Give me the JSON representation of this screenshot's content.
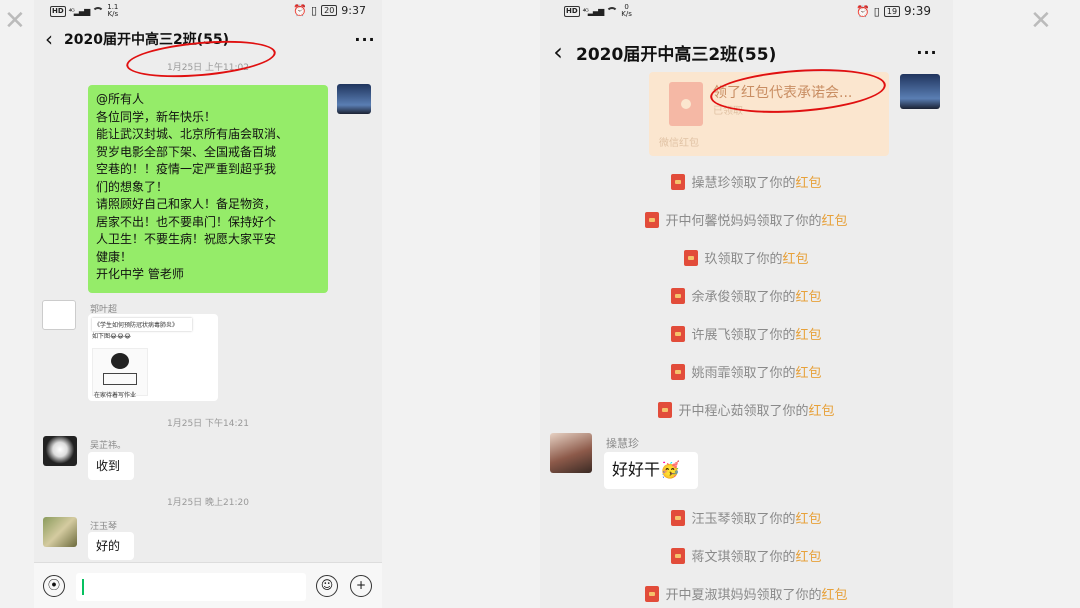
{
  "left": {
    "status": {
      "speed": "1.1\nK/s",
      "battery": "20",
      "time": "9:37"
    },
    "title": "2020届开中高三2班(55)",
    "timestamp1": "1月25日 上午11:02",
    "announcement": [
      "@所有人",
      "各位同学，新年快乐！",
      "能让武汉封城、北京所有庙会取消、",
      "贺岁电影全部下架、全国戒备百城",
      "空巷的！！疫情一定严重到超乎我",
      "们的想象了！",
      "请照顾好自己和家人！备足物资，",
      "居家不出！也不要串门！保持好个",
      "人卫生！不要生病！祝愿大家平安",
      "健康！",
      "开化中学    管老师"
    ],
    "sender1": "郭叶超",
    "image_msg": {
      "caption": "《学生如何预防冠状病毒肺炎》",
      "line2": "如下图😂😂😂",
      "footer": "在家待着写作业"
    },
    "timestamp2": "1月25日 下午14:21",
    "sender2": "吴芷祎。",
    "msg2": "收到",
    "timestamp3": "1月25日 晚上21:20",
    "sender3": "汪玉琴",
    "msg3": "好的"
  },
  "right": {
    "status": {
      "speed": "0\nK/s",
      "battery": "19",
      "time": "9:39"
    },
    "title": "2020届开中高三2班(55)",
    "redpacket": {
      "title": "领了红包代表承诺会...",
      "sub": "已领取",
      "label": "微信红包"
    },
    "system_suffix": "领取了你的",
    "hongbao_word": "红包",
    "claims_before": [
      "操慧珍",
      "开中何馨悦妈妈",
      "玖",
      "余承俊",
      "许展飞",
      "姚雨霏",
      "开中程心茹"
    ],
    "sender": "操慧珍",
    "msg": "好好干🥳",
    "claims_after": [
      "汪玉琴",
      "蒋文琪",
      "开中夏淑琪妈妈"
    ]
  },
  "colors": {
    "green_bubble": "#95ec69",
    "hongbao": "#e7a13a",
    "annotation": "#e01010"
  }
}
